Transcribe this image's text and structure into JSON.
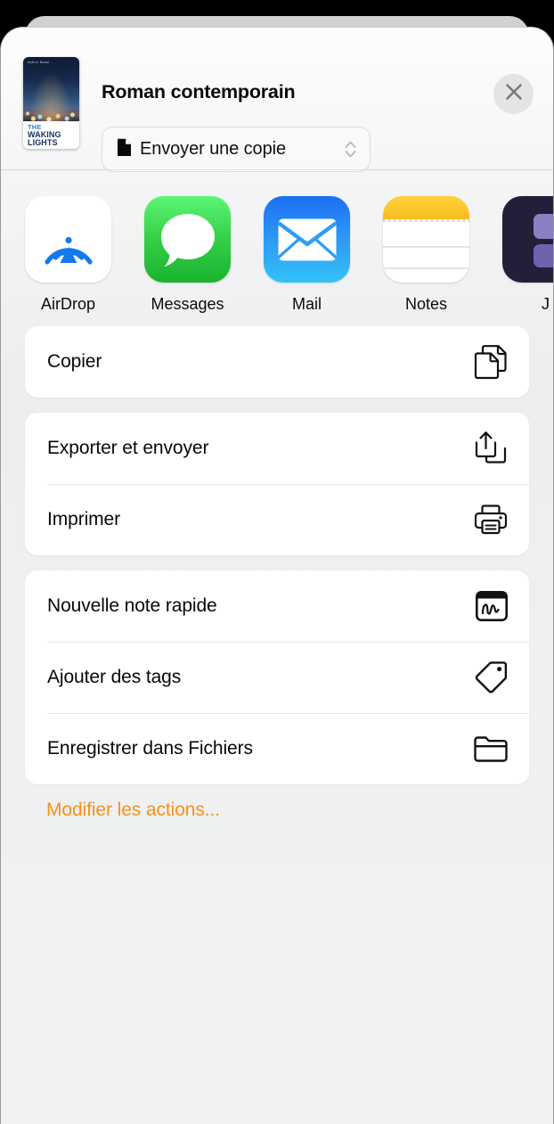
{
  "sheet": {
    "title": "Roman contemporain",
    "format_button": {
      "label": "Envoyer une copie",
      "icon": "document-icon",
      "stepper_icon": "up-down-chevron-icon"
    },
    "close_label": "×",
    "thumbnail": {
      "byline": "Author Name",
      "title_line1": "THE",
      "title_line2": "WAKING",
      "title_line3": "LIGHTS"
    }
  },
  "apps": [
    {
      "label": "AirDrop",
      "icon": "airdrop-icon"
    },
    {
      "label": "Messages",
      "icon": "messages-icon"
    },
    {
      "label": "Mail",
      "icon": "mail-icon"
    },
    {
      "label": "Notes",
      "icon": "notes-icon"
    },
    {
      "label": "J",
      "icon": "journal-icon"
    }
  ],
  "groups": [
    {
      "rows": [
        {
          "label": "Copier",
          "icon": "copy-icon"
        }
      ]
    },
    {
      "rows": [
        {
          "label": "Exporter et envoyer",
          "icon": "share-stack-icon"
        },
        {
          "label": "Imprimer",
          "icon": "printer-icon"
        }
      ]
    },
    {
      "rows": [
        {
          "label": "Nouvelle note rapide",
          "icon": "quick-note-icon"
        },
        {
          "label": "Ajouter des tags",
          "icon": "tag-icon"
        },
        {
          "label": "Enregistrer dans Fichiers",
          "icon": "folder-icon"
        }
      ]
    }
  ],
  "edit_actions": {
    "label": "Modifier les actions...",
    "color": "#F5911E"
  },
  "colors": {
    "accent_orange": "#F5911E",
    "sheet_background": "#EEF0F1",
    "row_background": "#FFFFFF",
    "airdrop_blue": "#1478F0",
    "messages_green": "#36D04A",
    "mail_blue": "#2E9DF5",
    "notes_yellow": "#FFD23A",
    "journal_dark": "#231F38",
    "close_button_background": "#E4E4E6"
  }
}
